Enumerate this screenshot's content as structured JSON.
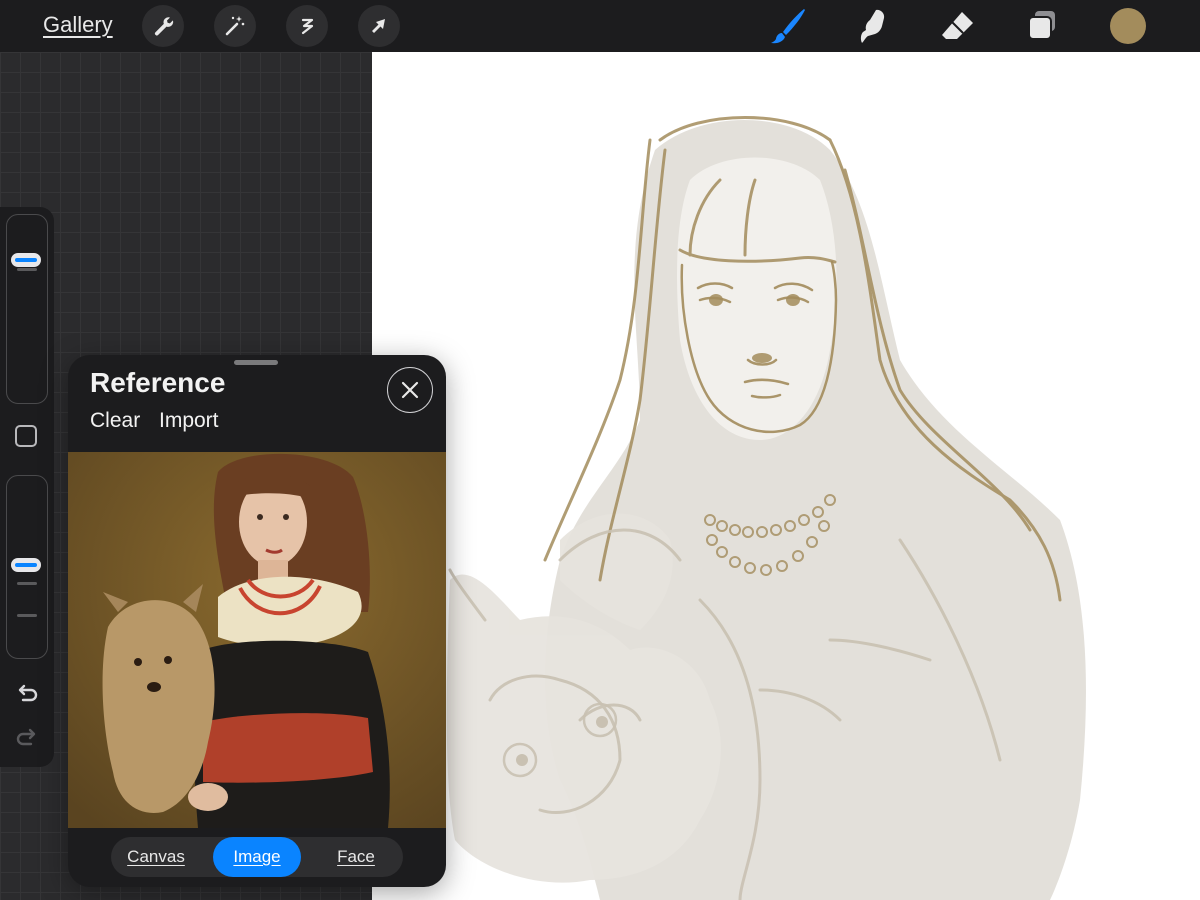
{
  "topbar": {
    "gallery_label": "Gallery",
    "left_tools": [
      "wrench-icon",
      "magic-wand-icon",
      "selection-icon",
      "transform-arrow-icon"
    ],
    "right_tools": [
      "brush-icon",
      "smudge-icon",
      "eraser-icon",
      "layers-icon"
    ],
    "active_tool": "brush-icon",
    "current_color": "#a38c5c"
  },
  "sidebar": {
    "brush_size_level": 0.22,
    "opacity_level": 0.49,
    "tools": [
      "modify-square-icon",
      "undo-icon",
      "redo-icon"
    ]
  },
  "reference": {
    "title": "Reference",
    "clear_label": "Clear",
    "import_label": "Import",
    "close_icon": "close-icon",
    "modes": [
      "Canvas",
      "Image",
      "Face"
    ],
    "active_mode": "Image"
  },
  "colors": {
    "accent": "#0a84ff",
    "sketch": "#a38c5c",
    "toolbar": "#1c1c1e"
  }
}
